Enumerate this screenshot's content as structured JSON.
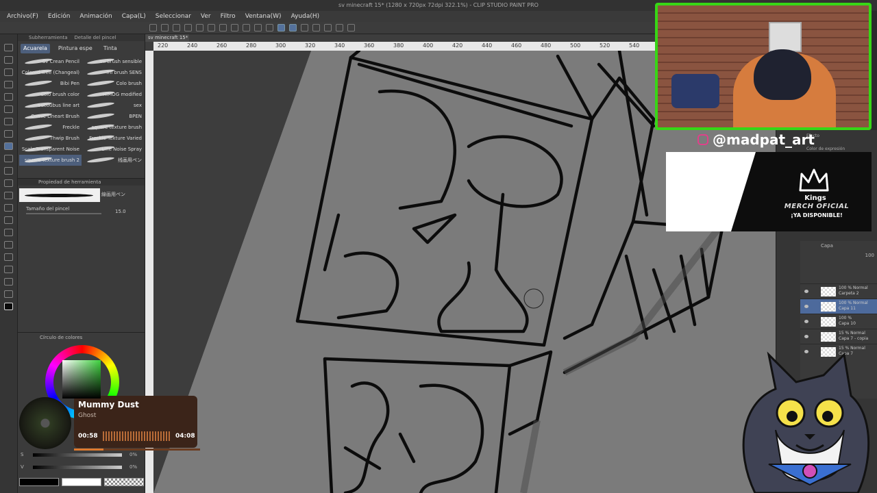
{
  "window": {
    "title": "sv minecraft 15* (1280 x 720px 72dpi 322.1%) - CLIP STUDIO PAINT PRO"
  },
  "menu": [
    "Archivo(F)",
    "Edición",
    "Animación",
    "Capa(L)",
    "Seleccionar",
    "Ver",
    "Filtro",
    "Ventana(W)",
    "Ayuda(H)"
  ],
  "subtool_panel": {
    "tabs": [
      "Subherramienta",
      "Detalle del pincel"
    ],
    "groups": [
      "Acuarela",
      "Pintura espe",
      "Tinta"
    ],
    "selected_group": "Acuarela",
    "brushes": [
      "Sv Crean Pencil",
      "mi brush sensible",
      "Colored Tree (Changeal)",
      "mi brush SENS",
      "Bibi Pen",
      "Colo brush",
      "Colo brush color",
      "HIMOG modified",
      "Sucoubus line art",
      "sex",
      "Comic Lineart Brush",
      "BPEN",
      "Freckle",
      "square texture brush",
      "Thwip Brush",
      "Freckle Texture Varied",
      "Scale Transparent Noise",
      "Line Noise Spray",
      "square texture brush 2",
      "线画用ペン"
    ],
    "selected_brush": "square texture brush 2"
  },
  "tool_property": {
    "header": "Propiedad de herramienta",
    "brush_name": "線画用ペン",
    "size_label": "Tamaño del pincel",
    "size_value": "15.0"
  },
  "color_panel": {
    "header": "Círculo de colores",
    "main_color": "#3fd33f",
    "s_label": "S",
    "v_label": "V",
    "s_value": "0%",
    "v_value": "0%"
  },
  "canvas": {
    "doc_tab": "sv minecraft 15*",
    "ruler_ticks": [
      "220",
      "240",
      "260",
      "280",
      "300",
      "320",
      "340",
      "360",
      "380",
      "400",
      "420",
      "440",
      "460",
      "480",
      "500",
      "520",
      "540"
    ]
  },
  "music": {
    "title": "Mummy Dust",
    "artist": "Ghost",
    "elapsed": "00:58",
    "duration": "04:08",
    "progress": 0.233
  },
  "stream": {
    "handle": "@madpat_art",
    "merch": {
      "brand": "Kings",
      "line1": "MERCH OFICIAL",
      "line2": "¡YA DISPONIBLE!"
    },
    "frame_color": "#37d616"
  },
  "right_panel": {
    "effect_label": "Efecto",
    "expression_label": "Color de expresión"
  },
  "layers": {
    "header": "Capa",
    "opacity": "100",
    "rows": [
      {
        "line1": "100 % Normal",
        "line2": "Carpeta 2"
      },
      {
        "line1": "100 % Normal",
        "line2": "Capa 11"
      },
      {
        "line1": "100 %",
        "line2": "Capa 10"
      },
      {
        "line1": "15 % Normal",
        "line2": "Capa 7 - copia"
      },
      {
        "line1": "15 % Normal",
        "line2": "Capa 7"
      }
    ],
    "selected_index": 1
  }
}
